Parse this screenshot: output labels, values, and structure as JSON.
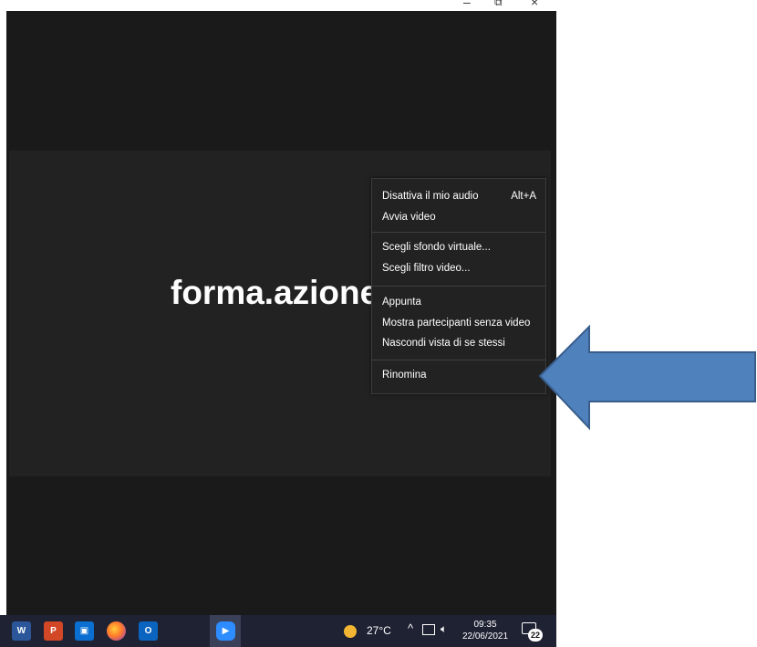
{
  "window": {
    "minimize_icon": "minimize-icon",
    "maximize_icon": "maximize-icon",
    "close_icon": "close-icon",
    "minimize_glyph": "–",
    "maximize_glyph": "⧉",
    "close_glyph": "×"
  },
  "meeting": {
    "participant_name": "forma.azione"
  },
  "context_menu": {
    "items": [
      {
        "label": "Disattiva il mio audio",
        "shortcut": "Alt+A"
      },
      {
        "label": "Avvia video"
      },
      {
        "label": "Scegli sfondo virtuale..."
      },
      {
        "label": "Scegli filtro video..."
      },
      {
        "label": "Appunta"
      },
      {
        "label": "Mostra partecipanti senza video"
      },
      {
        "label": "Nascondi vista di se stessi"
      },
      {
        "label": "Rinomina"
      }
    ]
  },
  "annotation": {
    "arrow_color": "#4f81bd",
    "arrow_border": "#385d8a"
  },
  "taskbar": {
    "apps": [
      {
        "name": "word-icon",
        "glyph": "W"
      },
      {
        "name": "powerpoint-icon",
        "glyph": "P"
      },
      {
        "name": "store-icon",
        "glyph": "▣"
      },
      {
        "name": "firefox-icon",
        "glyph": ""
      },
      {
        "name": "outlook-icon",
        "glyph": "O"
      },
      {
        "name": "zoom-icon",
        "glyph": "▶"
      }
    ],
    "temperature": "27°C",
    "time": "09:35",
    "date": "22/06/2021",
    "notification_count": "22"
  },
  "colors": {
    "meeting_bg": "#1a1a1a",
    "tile_bg": "#222222",
    "menu_bg": "#222222",
    "taskbar_bg": "#1f2233",
    "zoom_blue": "#2d8cff"
  }
}
